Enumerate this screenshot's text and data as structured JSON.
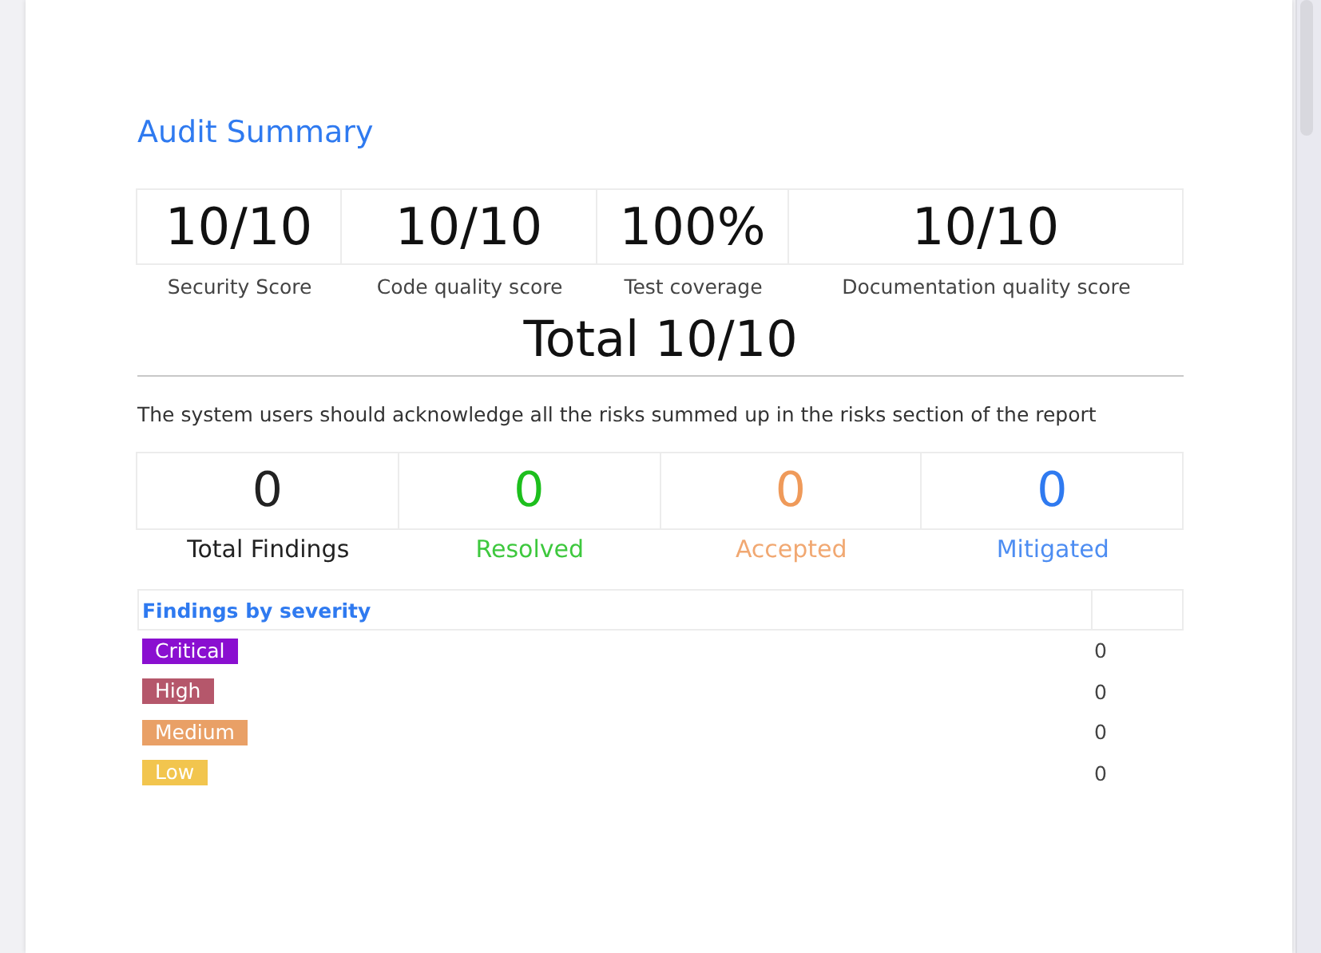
{
  "title": "Audit Summary",
  "scores": [
    {
      "value": "10/10",
      "label": "Security Score"
    },
    {
      "value": "10/10",
      "label": "Code quality score"
    },
    {
      "value": "100%",
      "label": "Test coverage"
    },
    {
      "value": "10/10",
      "label": "Documentation quality score"
    }
  ],
  "total": "Total 10/10",
  "note": "The system users should acknowledge all the risks summed up in the risks section of the report",
  "findings": [
    {
      "count": "0",
      "label": "Total Findings",
      "color": "#222222"
    },
    {
      "count": "0",
      "label": "Resolved",
      "color": "#1dbf1d"
    },
    {
      "count": "0",
      "label": "Accepted",
      "color": "#ef9a5a"
    },
    {
      "count": "0",
      "label": "Mitigated",
      "color": "#2f7af0"
    }
  ],
  "severity_table": {
    "heading": "Findings by severity",
    "rows": [
      {
        "severity": "Critical",
        "count": "0",
        "color": "#8a0fd0"
      },
      {
        "severity": "High",
        "count": "0",
        "color": "#b5576b"
      },
      {
        "severity": "Medium",
        "count": "0",
        "color": "#e9a066"
      },
      {
        "severity": "Low",
        "count": "0",
        "color": "#f2c54e"
      }
    ]
  }
}
